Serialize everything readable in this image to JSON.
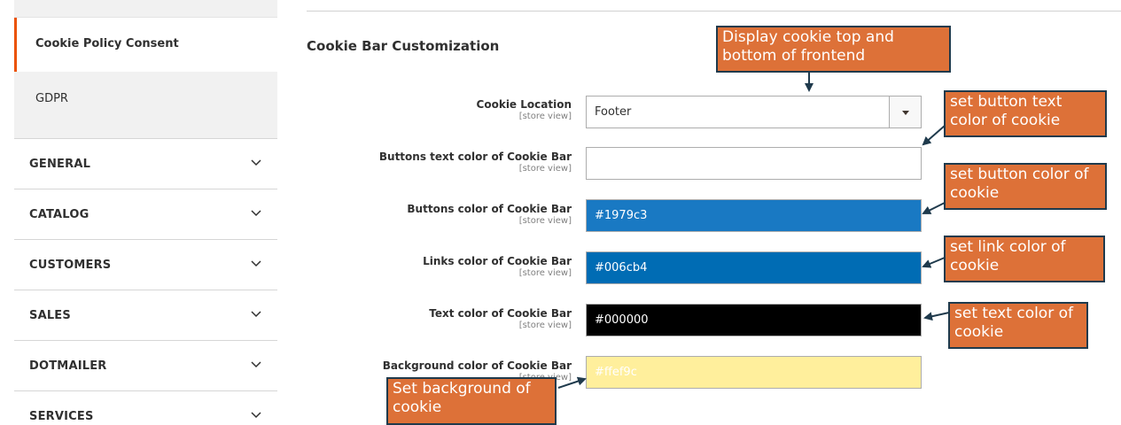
{
  "sidebar": {
    "active_item": "Cookie Policy Consent",
    "sub_item": "GDPR",
    "sections": [
      {
        "label": "GENERAL"
      },
      {
        "label": "CATALOG"
      },
      {
        "label": "CUSTOMERS"
      },
      {
        "label": "SALES"
      },
      {
        "label": "DOTMAILER"
      },
      {
        "label": "SERVICES"
      }
    ]
  },
  "main": {
    "section_title": "Cookie Bar Customization",
    "fields": [
      {
        "label": "Cookie Location",
        "scope": "[store view]",
        "value": "Footer",
        "bg": "#ffffff",
        "fg": "#303030"
      },
      {
        "label": "Buttons text color of Cookie Bar",
        "scope": "[store view]",
        "value": "",
        "bg": "#ffffff",
        "fg": "#303030"
      },
      {
        "label": "Buttons color of Cookie Bar",
        "scope": "[store view]",
        "value": "#1979c3",
        "bg": "#1979c3",
        "fg": "#ffffff"
      },
      {
        "label": "Links color of Cookie Bar",
        "scope": "[store view]",
        "value": "#006cb4",
        "bg": "#006cb4",
        "fg": "#ffffff"
      },
      {
        "label": "Text color of Cookie Bar",
        "scope": "[store view]",
        "value": "#000000",
        "bg": "#000000",
        "fg": "#ffffff"
      },
      {
        "label": "Background color of Cookie Bar",
        "scope": "[store view]",
        "value": "#ffef9c",
        "bg": "#ffef9c",
        "fg": "#ffffff"
      }
    ]
  },
  "callouts": {
    "location": "Display cookie top and bottom of frontend",
    "button_text": "set button text color of cookie",
    "button_color": "set button color of cookie",
    "link_color": "set link color of cookie",
    "text_color": "set text color of cookie",
    "background": "Set background of cookie"
  },
  "colors": {
    "accent": "#eb5202",
    "callout_fill": "#dd7138",
    "callout_border": "#1f3a4c"
  },
  "icons": {
    "section_toggle": "chevron-down-icon",
    "select_toggle": "caret-down-icon"
  }
}
